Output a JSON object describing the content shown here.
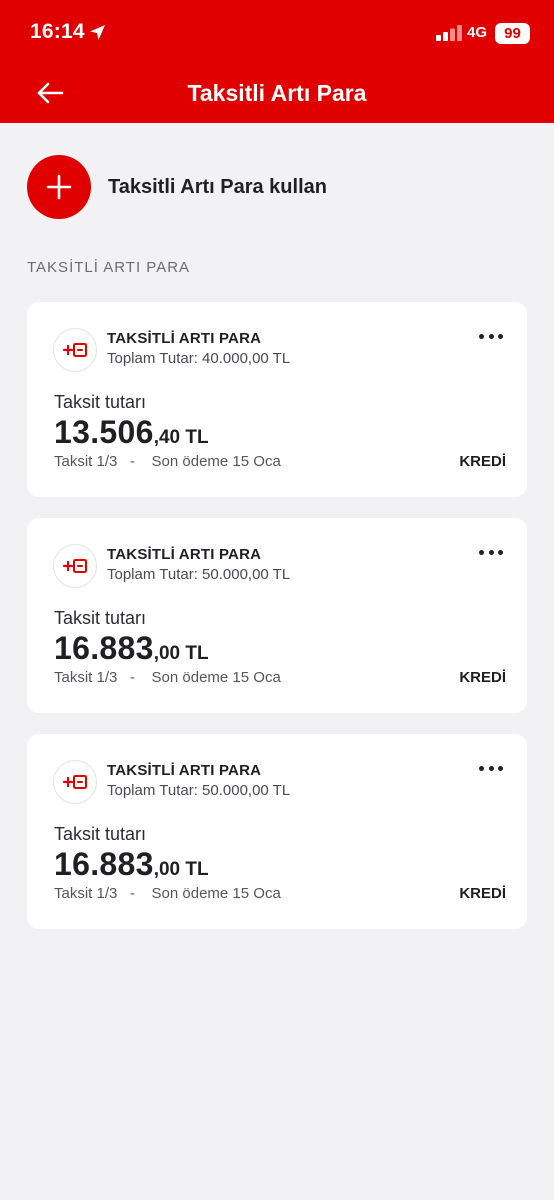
{
  "status_bar": {
    "time": "16:14",
    "network": "4G",
    "battery": "99"
  },
  "header": {
    "title": "Taksitli Artı Para"
  },
  "add_action": {
    "label": "Taksitli Artı Para kullan"
  },
  "section": {
    "title": "TAKSİTLİ ARTI PARA"
  },
  "cards": [
    {
      "title": "TAKSİTLİ ARTI PARA",
      "total": "Toplam Tutar: 40.000,00 TL",
      "installment_label": "Taksit tutarı",
      "amount_int": "13.506",
      "amount_dec": ",40 TL",
      "installment_info": "Taksit 1/3   -    Son ödeme 15 Oca",
      "type": "KREDİ"
    },
    {
      "title": "TAKSİTLİ ARTI PARA",
      "total": "Toplam Tutar: 50.000,00 TL",
      "installment_label": "Taksit tutarı",
      "amount_int": "16.883",
      "amount_dec": ",00 TL",
      "installment_info": "Taksit 1/3   -    Son ödeme 15 Oca",
      "type": "KREDİ"
    },
    {
      "title": "TAKSİTLİ ARTI PARA",
      "total": "Toplam Tutar: 50.000,00 TL",
      "installment_label": "Taksit tutarı",
      "amount_int": "16.883",
      "amount_dec": ",00 TL",
      "installment_info": "Taksit 1/3   -    Son ödeme 15 Oca",
      "type": "KREDİ"
    }
  ],
  "colors": {
    "brand_red": "#e00000",
    "background": "#f2f2f5",
    "card": "#ffffff"
  },
  "icons": {
    "back": "arrow-left-icon",
    "location": "location-arrow-icon",
    "signal": "cellular-signal-icon",
    "add": "plus-icon",
    "card": "plus-money-icon",
    "more": "more-dots-icon"
  }
}
